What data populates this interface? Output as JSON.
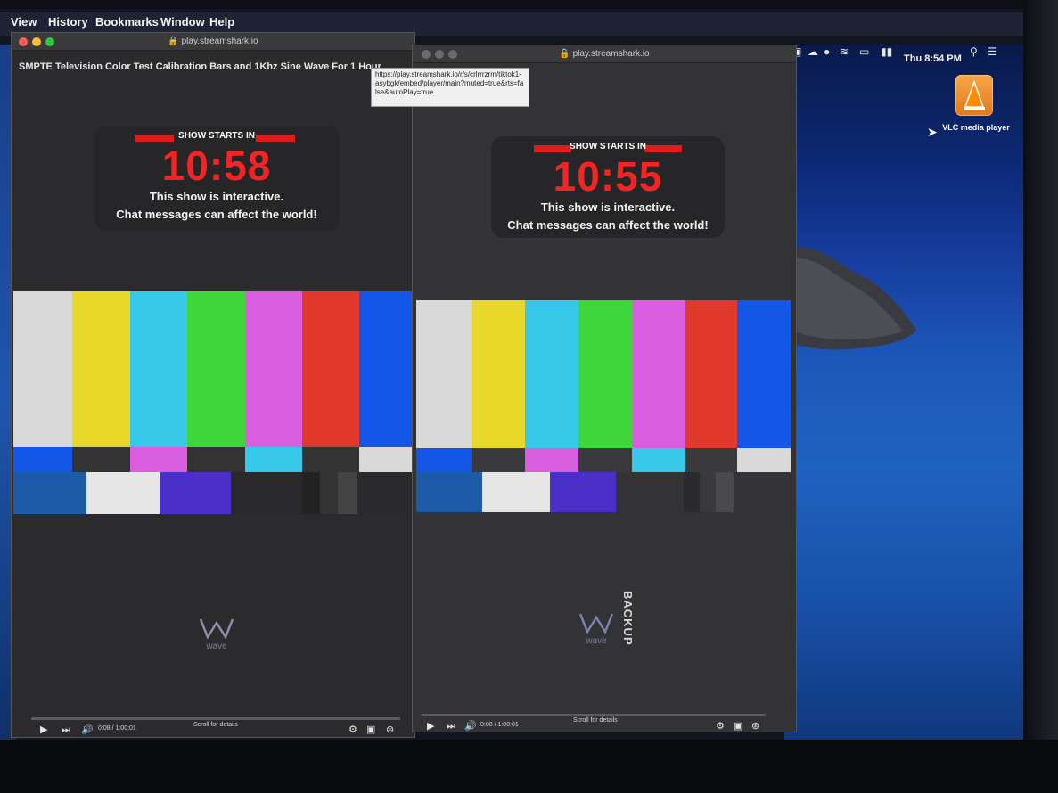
{
  "menubar": {
    "items": [
      "View",
      "History",
      "Bookmarks",
      "Window",
      "Help"
    ],
    "clock": "Thu 8:54 PM"
  },
  "tray_icons": [
    "screen-record-icon",
    "creative-cloud-icon",
    "orb-icon",
    "wifi-icon",
    "airplay-icon",
    "battery-icon",
    "spotlight-icon",
    "control-center-icon"
  ],
  "desktop": {
    "vlc_label": "VLC media player"
  },
  "window1": {
    "url": "play.streamshark.io",
    "video_title": "SMPTE Television Color Test Calibration Bars and 1Khz Sine Wave For 1 Hour",
    "countdown": {
      "label": "SHOW STARTS IN",
      "time": "10:58",
      "line1": "This show is interactive.",
      "line2": "Chat messages can affect the world!"
    },
    "logo_text": "wave",
    "controls": {
      "time": "0:08 / 1:00:01",
      "scroll": "Scroll for details"
    }
  },
  "window2": {
    "url": "play.streamshark.io",
    "countdown": {
      "label": "SHOW STARTS IN",
      "time": "10:55",
      "line1": "This show is interactive.",
      "line2": "Chat messages can affect the world!"
    },
    "logo_text": "wave",
    "backup_label": "BACKUP",
    "controls": {
      "time": "0:08 / 1:00:01",
      "scroll": "Scroll for details"
    }
  },
  "tooltip": {
    "text": "https://play.streamshark.io/r/s/crlrrrzrm/tiktok1-asybgk/embed/player/main?muted=true&rts=false&autoPlay=true"
  },
  "colors": {
    "bar_white": "#d9d9d9",
    "bar_yellow": "#e8d829",
    "bar_cyan": "#36c8e8",
    "bar_green": "#3ed63a",
    "bar_magenta": "#d95ee0",
    "bar_red": "#e13a2c",
    "bar_blue": "#1457e8",
    "countdown_red": "#f22424"
  }
}
